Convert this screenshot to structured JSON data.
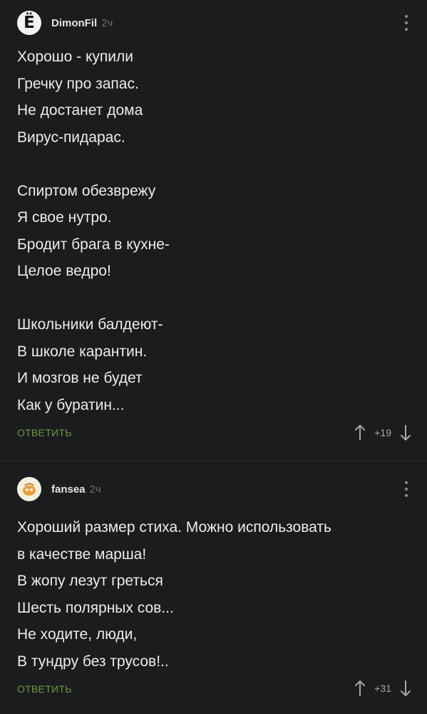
{
  "comments": [
    {
      "username": "DimonFil",
      "time": "2ч",
      "avatar_letter": "Ё",
      "text": "Хорошо - купили\nГречку про запас.\nНе достанет дома\nВирус-пидарас.\n\nСпиртом обезврежу\nЯ свое нутро.\nБродит брага в кухне-\nЦелое ведро!\n\nШкольники балдеют-\nВ школе карантин.\nИ мозгов не будет\nКак у буратин...",
      "reply_label": "ОТВЕТИТЬ",
      "rating": "+19"
    },
    {
      "username": "fansea",
      "time": "2ч",
      "text": "Хороший размер стиха. Можно использовать\nв качестве марша!\nВ жопу лезут греться\nШесть полярных сов...\nНе ходите, люди,\nВ тундру без трусов!..",
      "reply_label": "ОТВЕТИТЬ",
      "rating": "+31"
    }
  ],
  "icons": {
    "more": "more-vertical-icon",
    "upvote": "arrow-up-icon",
    "downvote": "arrow-down-icon"
  },
  "colors": {
    "background": "#1b1c1e",
    "reply": "#6c9b43",
    "muted": "#6a6b6f"
  }
}
